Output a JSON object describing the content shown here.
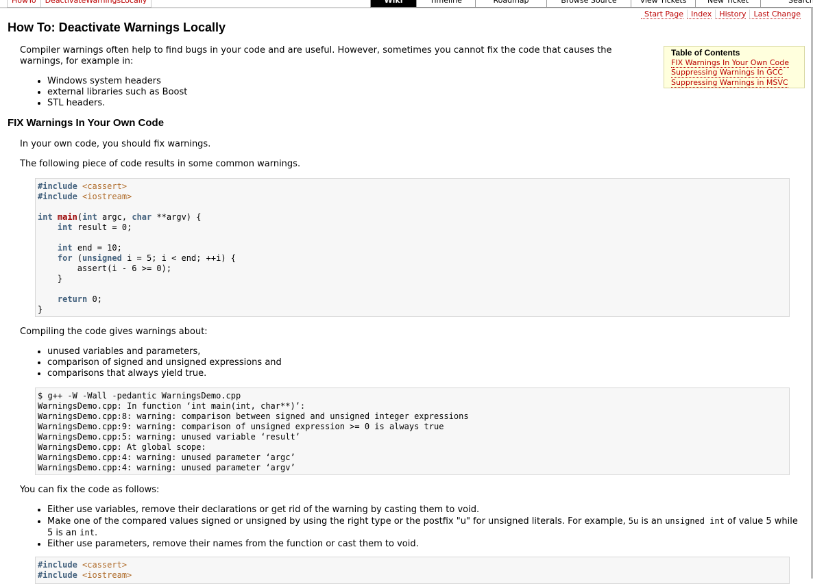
{
  "breadcrumb": [
    "HowTo",
    "DeactivateWarningsLocally"
  ],
  "mainnav": [
    {
      "label": "Wiki",
      "w": 66
    },
    {
      "label": "Timeline",
      "w": 85
    },
    {
      "label": "Roadmap",
      "w": 103
    },
    {
      "label": "Browse Source",
      "w": 122
    },
    {
      "label": "View Tickets",
      "w": 93
    },
    {
      "label": "New Ticket",
      "w": 94
    },
    {
      "label": "Search",
      "w": 118
    }
  ],
  "metanav": [
    "Start Page",
    "Index",
    "History",
    "Last Change"
  ],
  "page": {
    "title": "How To: Deactivate Warnings Locally",
    "intro": "Compiler warnings often help to find bugs in your code and are useful. However, sometimes you cannot fix the code that causes the warnings, for example in:",
    "intro_list": [
      "Windows system headers",
      "external libraries such as Boost",
      "STL headers."
    ],
    "section1_title": "FIX Warnings In Your Own Code",
    "section1_p1": "In your own code, you should fix warnings.",
    "section1_p2": "The following piece of code results in some common warnings.",
    "compile_intro": "Compiling the code gives warnings about:",
    "warning_list": [
      "unused variables and parameters,",
      "comparison of signed and unsigned expressions and",
      "comparisons that always yield true."
    ],
    "fix_intro": "You can fix the code as follows:",
    "fix_list": {
      "item1": "Either use variables, remove their declarations or get rid of the warning by casting them to void.",
      "item2_a": "Make one of the compared values signed or unsigned by using the right type or the postfix \"u\" for unsigned literals. For example, ",
      "item2_code1": "5u",
      "item2_b": " is an ",
      "item2_code2": "unsigned int",
      "item2_c": " of value 5 while 5 is an ",
      "item2_code3": "int",
      "item2_d": ".",
      "item3": "Either use parameters, remove their names from the function or cast them to void."
    }
  },
  "code1": {
    "inc1_kw": "#include",
    "inc1_file": "<cassert>",
    "inc2_kw": "#include",
    "inc2_file": "<iostream>",
    "main_type": "int",
    "main_name": "main",
    "main_args_a": "(",
    "main_args_int": "int",
    "main_args_b": " argc, ",
    "main_args_char": "char",
    "main_args_c": " **argv) {",
    "l_result_type": "int",
    "l_result": " result = 0;",
    "l_end_type": "int",
    "l_end": " end = 10;",
    "l_for_kw": "for",
    "l_for_a": " (",
    "l_for_unsigned": "unsigned",
    "l_for_b": " i = 5; i < end; ++i) {",
    "l_assert": "assert(i - 6 >= 0);",
    "l_close_inner": "}",
    "l_return_kw": "return",
    "l_return": " 0;",
    "l_close": "}"
  },
  "terminal_output": [
    "$ g++ -W -Wall -pedantic WarningsDemo.cpp",
    "WarningsDemo.cpp: In function ‘int main(int, char**)’:",
    "WarningsDemo.cpp:8: warning: comparison between signed and unsigned integer expressions",
    "WarningsDemo.cpp:9: warning: comparison of unsigned expression >= 0 is always true",
    "WarningsDemo.cpp:5: warning: unused variable ‘result’",
    "WarningsDemo.cpp: At global scope:",
    "WarningsDemo.cpp:4: warning: unused parameter ‘argc’",
    "WarningsDemo.cpp:4: warning: unused parameter ‘argv’"
  ],
  "code2": {
    "inc1_kw": "#include",
    "inc1_file": "<cassert>",
    "inc2_kw": "#include",
    "inc2_file": "<iostream>"
  },
  "toc": {
    "title": "Table of Contents",
    "items": [
      "FIX Warnings In Your Own Code",
      "Suppressing Warnings In GCC",
      "Suppressing Warnings in MSVC"
    ]
  },
  "colors": {
    "link": "#bb0000",
    "keyword": "#44627e",
    "include_file": "#b06d2c",
    "function_name": "#990000",
    "code_bg": "#f7f7f7",
    "toc_bg": "#ffffdd"
  }
}
